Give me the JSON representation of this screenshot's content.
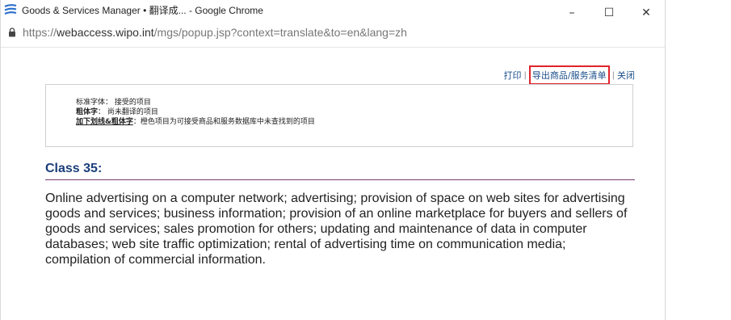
{
  "window": {
    "title": "Goods & Services Manager • 翻译成... - Google Chrome",
    "minimize": "–",
    "maximize": "☐",
    "close": "✕"
  },
  "address": {
    "scheme": "https://",
    "host": "webaccess.wipo.int",
    "path": "/mgs/popup.jsp?context=translate&to=en&lang=zh"
  },
  "links": {
    "print": "打印",
    "export": "导出商品/服务清单",
    "close": "关闭",
    "separator": "|"
  },
  "legend": {
    "line1": "标准字体： 接受的项目",
    "line2_label": "粗体字",
    "line2_text": "： 尚未翻译的项目",
    "line3_label": "加下划线&粗体字",
    "line3_text": "：橙色项目为可接受商品和服务数据库中未查找到的项目"
  },
  "content": {
    "class_heading": "Class 35:",
    "class_text": "Online advertising on a computer network; advertising; provision of space on web sites for advertising goods and services; business information; provision of an online marketplace for buyers and sellers of goods and services; sales promotion for others; updating and maintenance of data in computer databases; web site traffic optimization; rental of advertising time on communication media; compilation of commercial information."
  },
  "colors": {
    "link": "#1a4e8a",
    "highlight_border": "#e0232b",
    "heading": "#1a3e7a",
    "heading_rule": "#7a3a73"
  }
}
